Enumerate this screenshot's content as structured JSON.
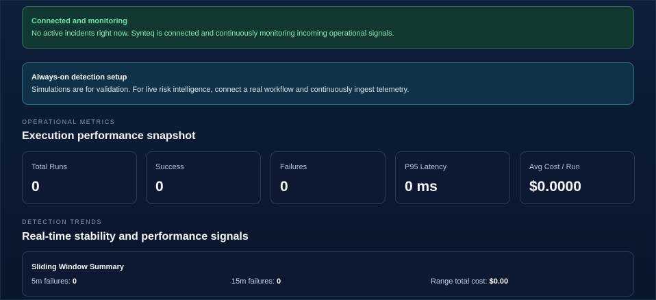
{
  "banners": {
    "status": {
      "title": "Connected and monitoring",
      "text": "No active incidents right now. Synteq is connected and continuously monitoring incoming operational signals."
    },
    "setup": {
      "title": "Always-on detection setup",
      "text": "Simulations are for validation. For live risk intelligence, connect a real workflow and continuously ingest telemetry."
    }
  },
  "metrics_section": {
    "eyebrow": "OPERATIONAL METRICS",
    "title": "Execution performance snapshot",
    "cards": [
      {
        "label": "Total Runs",
        "value": "0"
      },
      {
        "label": "Success",
        "value": "0"
      },
      {
        "label": "Failures",
        "value": "0"
      },
      {
        "label": "P95 Latency",
        "value": "0 ms"
      },
      {
        "label": "Avg Cost / Run",
        "value": "$0.0000"
      }
    ]
  },
  "trends_section": {
    "eyebrow": "DETECTION TRENDS",
    "title": "Real-time stability and performance signals",
    "summary": {
      "title": "Sliding Window Summary",
      "items": [
        {
          "label": "5m failures:",
          "value": "0"
        },
        {
          "label": "15m failures:",
          "value": "0"
        },
        {
          "label": "Range total cost:",
          "value": "$0.00"
        }
      ]
    }
  },
  "colors": {
    "background": "#0c1a33",
    "success_banner": "#113831",
    "success_text": "#6fe0a8",
    "info_banner": "#0f3248",
    "card_border": "#2a3b58"
  }
}
